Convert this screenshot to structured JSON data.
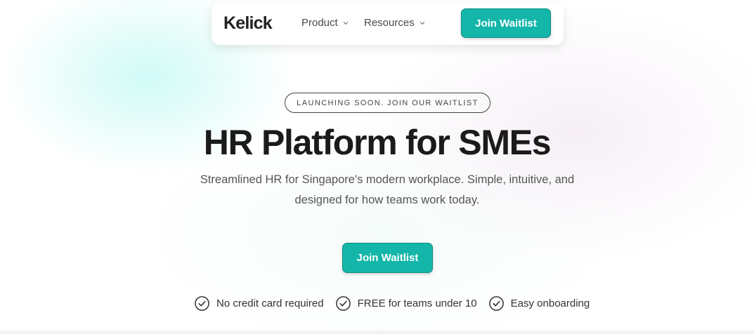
{
  "navbar": {
    "logo": "Kelick",
    "items": [
      {
        "label": "Product",
        "icon": "chevron-down-icon"
      },
      {
        "label": "Resources",
        "icon": "chevron-down-icon"
      }
    ],
    "cta_label": "Join Waitlist"
  },
  "hero": {
    "badge": "LAUNCHING SOON. JOIN OUR WAITLIST",
    "headline": "HR Platform for SMEs",
    "subtext": "Streamlined HR for Singapore's modern workplace. Simple, intuitive, and designed for how teams work today.",
    "cta_label": "Join Waitlist",
    "features": [
      {
        "label": "No credit card required",
        "icon": "check-circle-icon"
      },
      {
        "label": "FREE for teams under 10",
        "icon": "check-circle-icon"
      },
      {
        "label": "Easy onboarding",
        "icon": "check-circle-icon"
      }
    ]
  },
  "colors": {
    "accent": "#13b6a8",
    "accent_border": "#0e8f84",
    "text_dark": "#1b1b1b",
    "text_muted": "#555555"
  }
}
